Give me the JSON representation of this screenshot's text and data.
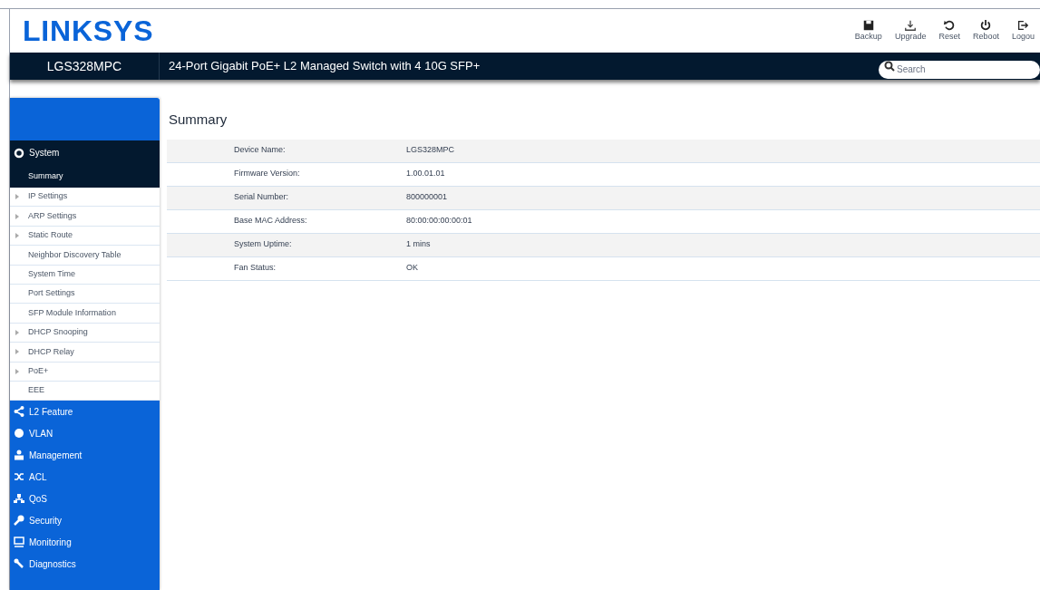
{
  "header": {
    "logo": "LINKSYS",
    "toolbar": [
      {
        "label": "Backup"
      },
      {
        "label": "Upgrade"
      },
      {
        "label": "Reset"
      },
      {
        "label": "Reboot"
      },
      {
        "label": "Logou"
      }
    ]
  },
  "title_bar": {
    "model": "LGS328MPC",
    "description": "24-Port Gigabit PoE+ L2 Managed Switch with 4 10G SFP+",
    "search": {
      "placeholder": "Search"
    }
  },
  "sidebar": {
    "sections": [
      {
        "label": "System",
        "expanded": true,
        "children": [
          {
            "label": "Summary",
            "selected": true,
            "expandable": false
          },
          {
            "label": "IP Settings",
            "selected": false,
            "expandable": true
          },
          {
            "label": "ARP Settings",
            "selected": false,
            "expandable": true
          },
          {
            "label": "Static Route",
            "selected": false,
            "expandable": true
          },
          {
            "label": "Neighbor Discovery Table",
            "selected": false,
            "expandable": false
          },
          {
            "label": "System Time",
            "selected": false,
            "expandable": false
          },
          {
            "label": "Port Settings",
            "selected": false,
            "expandable": false
          },
          {
            "label": "SFP Module Information",
            "selected": false,
            "expandable": false
          },
          {
            "label": "DHCP Snooping",
            "selected": false,
            "expandable": true
          },
          {
            "label": "DHCP Relay",
            "selected": false,
            "expandable": true
          },
          {
            "label": "PoE+",
            "selected": false,
            "expandable": true
          },
          {
            "label": "EEE",
            "selected": false,
            "expandable": false
          }
        ]
      },
      {
        "label": "L2 Feature",
        "expanded": false
      },
      {
        "label": "VLAN",
        "expanded": false
      },
      {
        "label": "Management",
        "expanded": false
      },
      {
        "label": "ACL",
        "expanded": false
      },
      {
        "label": "QoS",
        "expanded": false
      },
      {
        "label": "Security",
        "expanded": false
      },
      {
        "label": "Monitoring",
        "expanded": false
      },
      {
        "label": "Diagnostics",
        "expanded": false
      }
    ]
  },
  "content": {
    "title": "Summary",
    "rows": [
      {
        "label": "Device Name:",
        "value": "LGS328MPC"
      },
      {
        "label": "Firmware Version:",
        "value": "1.00.01.01"
      },
      {
        "label": "Serial Number:",
        "value": "800000001"
      },
      {
        "label": "Base MAC Address:",
        "value": "80:00:00:00:00:01"
      },
      {
        "label": "System Uptime:",
        "value": "1 mins"
      },
      {
        "label": "Fan Status:",
        "value": "OK"
      }
    ]
  }
}
